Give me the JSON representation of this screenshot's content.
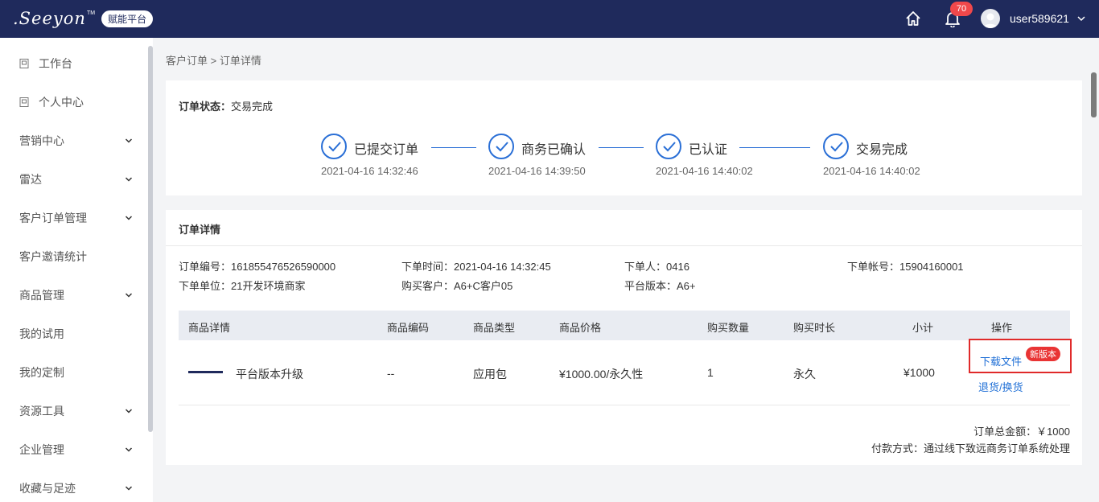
{
  "topbar": {
    "logo_text": ".Seeyon",
    "logo_tm": "TM",
    "logo_badge": "赋能平台",
    "notification_count": "70",
    "username": "user589621",
    "icons": [
      "home-icon",
      "bell-icon",
      "avatar",
      "chevron-down-icon"
    ]
  },
  "sidebar": {
    "items": [
      {
        "label": "工作台",
        "icon": "page-icon",
        "expandable": false
      },
      {
        "label": "个人中心",
        "icon": "page-icon",
        "expandable": false
      },
      {
        "label": "营销中心",
        "expandable": true
      },
      {
        "label": "雷达",
        "expandable": true
      },
      {
        "label": "客户订单管理",
        "expandable": true
      },
      {
        "label": "客户邀请统计",
        "expandable": false
      },
      {
        "label": "商品管理",
        "expandable": true
      },
      {
        "label": "我的试用",
        "expandable": false
      },
      {
        "label": "我的定制",
        "expandable": false
      },
      {
        "label": "资源工具",
        "expandable": true
      },
      {
        "label": "企业管理",
        "expandable": true
      },
      {
        "label": "收藏与足迹",
        "expandable": true
      }
    ]
  },
  "breadcrumb": "客户订单 > 订单详情",
  "order_status": {
    "label": "订单状态：",
    "value": "交易完成",
    "steps": [
      {
        "title": "已提交订单",
        "time": "2021-04-16 14:32:46"
      },
      {
        "title": "商务已确认",
        "time": "2021-04-16 14:39:50"
      },
      {
        "title": "已认证",
        "time": "2021-04-16 14:40:02"
      },
      {
        "title": "交易完成",
        "time": "2021-04-16 14:40:02"
      }
    ],
    "accent_color": "#2a6fd6"
  },
  "order_detail": {
    "title": "订单详情",
    "fields": {
      "order_no": "订单编号：161855476526590000",
      "order_time": "下单时间：2021-04-16 14:32:45",
      "orderer": "下单人：0416",
      "account": "下单帐号：15904160001",
      "unit": "下单单位：21开发环境商家",
      "customer": "购买客户：A6+C客户05",
      "platform_version": "平台版本：A6+"
    },
    "table": {
      "headers": [
        "商品详情",
        "商品编码",
        "商品类型",
        "商品价格",
        "购买数量",
        "购买时长",
        "小计",
        "操作"
      ],
      "rows": [
        {
          "name": "平台版本升级",
          "code": "--",
          "type": "应用包",
          "price": "¥1000.00/永久性",
          "quantity": "1",
          "duration": "永久",
          "subtotal": "¥1000",
          "actions": {
            "download": "下载文件",
            "new_badge": "新版本",
            "return": "退货/换货"
          }
        }
      ]
    },
    "total": "订单总金额：￥1000",
    "payment": "付款方式：通过线下致远商务订单系统处理"
  }
}
